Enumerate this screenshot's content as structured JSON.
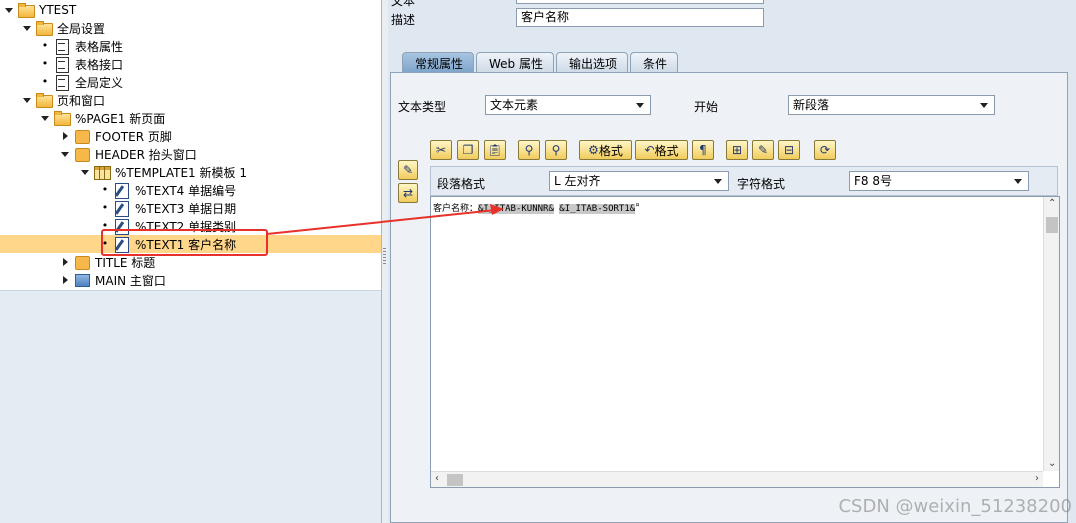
{
  "tree": {
    "items": [
      {
        "label": "YTEST",
        "icon": "folder-open-icon"
      },
      {
        "label": "全局设置",
        "icon": "folder-open-icon"
      },
      {
        "label": "表格属性",
        "icon": "document-icon"
      },
      {
        "label": "表格接口",
        "icon": "document-icon"
      },
      {
        "label": "全局定义",
        "icon": "document-icon"
      },
      {
        "label": "页和窗口",
        "icon": "folder-open-icon"
      },
      {
        "label": "%PAGE1 新页面",
        "icon": "folder-open-icon"
      },
      {
        "label": "FOOTER 页脚",
        "icon": "window-folder-icon"
      },
      {
        "label": "HEADER 抬头窗口",
        "icon": "window-folder-icon"
      },
      {
        "label": "%TEMPLATE1 新模板 1",
        "icon": "table-icon"
      },
      {
        "label": "%TEXT4 单据编号",
        "icon": "text-edit-icon"
      },
      {
        "label": "%TEXT3 单据日期",
        "icon": "text-edit-icon"
      },
      {
        "label": "%TEXT2 单据类别",
        "icon": "text-edit-icon"
      },
      {
        "label": "%TEXT1 客户名称",
        "icon": "text-edit-icon"
      },
      {
        "label": "TITLE 标题",
        "icon": "window-folder-icon"
      },
      {
        "label": "MAIN 主窗口",
        "icon": "window-icon"
      }
    ],
    "selected_index": 13
  },
  "header": {
    "name_label": "文本",
    "desc_label": "描述",
    "desc_value": "客户名称"
  },
  "tabs": [
    "常规属性",
    "Web 属性",
    "输出选项",
    "条件"
  ],
  "general": {
    "text_type_label": "文本类型",
    "text_type_value": "文本元素",
    "start_label": "开始",
    "start_value": "新段落"
  },
  "toolbar": {
    "format_btn1": "格式",
    "format_btn2": "格式",
    "paragraph_mark": "¶"
  },
  "format_bar": {
    "para_label": "段落格式",
    "para_value": "L 左对齐",
    "char_label": "字符格式",
    "char_value": "F8 8号"
  },
  "editor": {
    "prefix": "客户名称：",
    "field1": "&I_ITAB-KUNNR&",
    "field2": "&I_ITAB-SORT1&",
    "end_mark": "¤"
  },
  "watermark": "CSDN @weixin_51238200",
  "colors": {
    "selected_row": "#ffd68a",
    "callout": "#e8312a",
    "active_tab": "#8fb0d6"
  }
}
